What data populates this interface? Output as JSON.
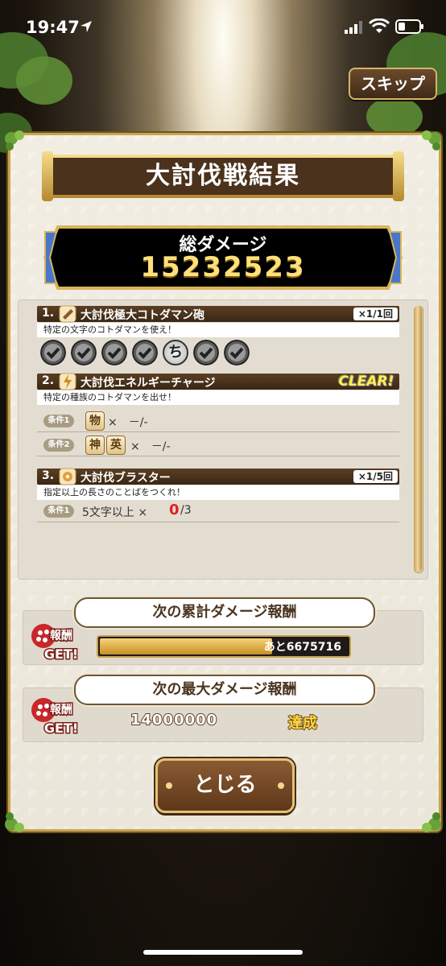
{
  "status": {
    "time": "19:47"
  },
  "skip_label": "スキップ",
  "title": "大討伐戦結果",
  "total_damage": {
    "label": "総ダメージ",
    "value": "15232523"
  },
  "missions": [
    {
      "index": "1.",
      "name": "大討伐極大コトダマン砲",
      "progress": "×1/1回",
      "desc": "特定の文字のコトダマンを使え！",
      "stones": [
        "check",
        "check",
        "check",
        "check",
        "ち",
        "check",
        "check"
      ]
    },
    {
      "index": "2.",
      "name": "大討伐エネルギーチャージ",
      "status": "CLEAR!",
      "desc": "特定の種族のコトダマンを出せ！",
      "conditions": [
        {
          "tag": "条件1",
          "tiles": [
            "物"
          ],
          "text": "×　－/-"
        },
        {
          "tag": "条件2",
          "tiles": [
            "神",
            "英"
          ],
          "text": "×　－/-"
        }
      ]
    },
    {
      "index": "3.",
      "name": "大討伐ブラスター",
      "progress": "×1/5回",
      "desc": "指定以上の長さのことばをつくれ！",
      "conditions": [
        {
          "tag": "条件1",
          "text": "5文字以上 ×",
          "current": "0",
          "target": "/3"
        }
      ]
    }
  ],
  "cumulative_reward": {
    "label": "次の累計ダメージ報酬",
    "icon_text": "報酬GET!",
    "remaining": "あと6675716",
    "progress_fraction": 0.7
  },
  "max_reward": {
    "label": "次の最大ダメージ報酬",
    "icon_text": "報酬GET!",
    "value": "14000000",
    "status": "達成"
  },
  "close_label": "とじる",
  "colors": {
    "accent_gold": "#c9a54c",
    "banner_brown": "#4a321c",
    "clear_yellow": "#fff14a",
    "alert_red": "#e02020"
  }
}
